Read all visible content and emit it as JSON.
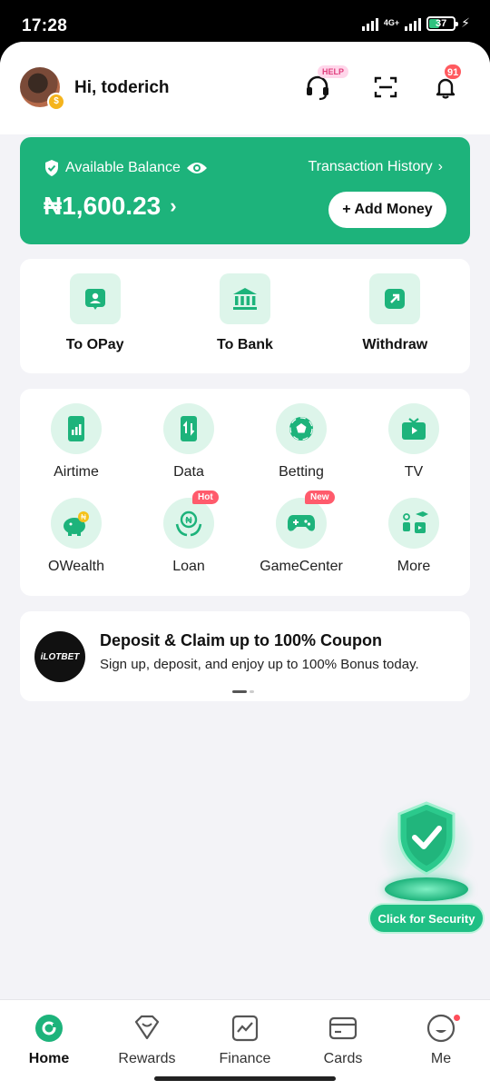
{
  "status_bar": {
    "time": "17:28",
    "network": "4G+",
    "battery": "37",
    "battery_level": 0.37
  },
  "header": {
    "greeting": "Hi, toderich",
    "help_badge": "HELP",
    "notification_count": "91"
  },
  "balance": {
    "label": "Available Balance",
    "amount": "₦1,600.23",
    "history_link": "Transaction History",
    "add_money_label": "+ Add Money"
  },
  "transfers": [
    {
      "label": "To OPay",
      "icon": "user-card-icon"
    },
    {
      "label": "To Bank",
      "icon": "bank-icon"
    },
    {
      "label": "Withdraw",
      "icon": "withdraw-icon"
    }
  ],
  "services": [
    {
      "label": "Airtime",
      "icon": "airtime-phone-icon",
      "tag": ""
    },
    {
      "label": "Data",
      "icon": "data-phone-icon",
      "tag": ""
    },
    {
      "label": "Betting",
      "icon": "soccer-ball-icon",
      "tag": ""
    },
    {
      "label": "TV",
      "icon": "tv-icon",
      "tag": ""
    },
    {
      "label": "OWealth",
      "icon": "piggy-bank-icon",
      "tag": ""
    },
    {
      "label": "Loan",
      "icon": "loan-hands-icon",
      "tag": "Hot"
    },
    {
      "label": "GameCenter",
      "icon": "gamepad-icon",
      "tag": "New"
    },
    {
      "label": "More",
      "icon": "more-apps-icon",
      "tag": ""
    }
  ],
  "promo": {
    "logo_text": "iLOTBET",
    "title": "Deposit & Claim up to 100% Coupon",
    "subtitle": "Sign up, deposit, and enjoy up to 100% Bonus today."
  },
  "security": {
    "button_label": "Click for Security"
  },
  "bottom_nav": [
    {
      "label": "Home",
      "icon": "home-icon",
      "active": true
    },
    {
      "label": "Rewards",
      "icon": "rewards-icon",
      "active": false
    },
    {
      "label": "Finance",
      "icon": "finance-chart-icon",
      "active": false
    },
    {
      "label": "Cards",
      "icon": "card-icon",
      "active": false
    },
    {
      "label": "Me",
      "icon": "me-face-icon",
      "active": false
    }
  ],
  "colors": {
    "brand": "#1db37b",
    "icon_bg": "#ddf5ea",
    "badge": "#ff5a5f"
  }
}
